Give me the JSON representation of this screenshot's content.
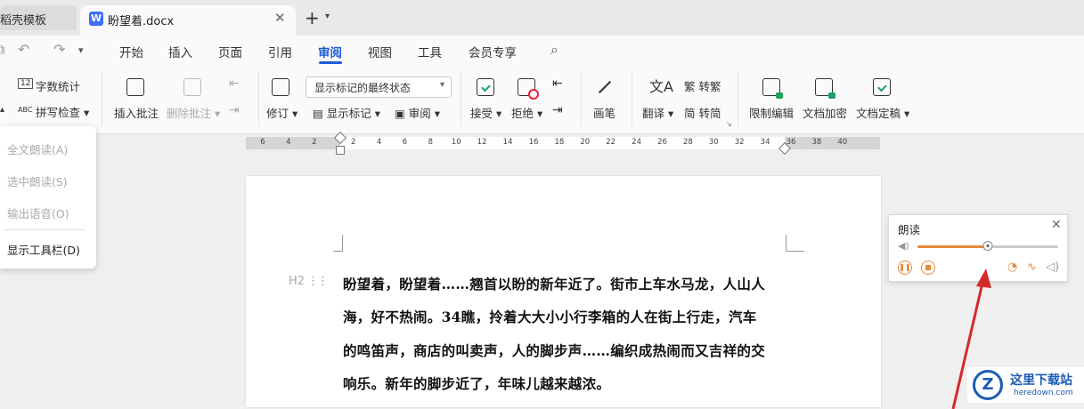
{
  "tabs": {
    "inactive_label": "稻壳模板",
    "active_label": "盼望着.docx",
    "doc_icon_letter": "W"
  },
  "menu": {
    "items": [
      "开始",
      "插入",
      "页面",
      "引用",
      "审阅",
      "视图",
      "工具",
      "会员专享"
    ],
    "active": "审阅"
  },
  "ribbon": {
    "word_count": "字数统计",
    "spell_check": "拼写检查",
    "insert_comment": "插入批注",
    "delete_comment": "删除批注",
    "revise": "修订",
    "markup_state": "显示标记的最终状态",
    "show_markup": "显示标记",
    "review": "审阅",
    "accept": "接受",
    "reject": "拒绝",
    "pen": "画笔",
    "translate": "翻译",
    "to_traditional": "转繁",
    "to_simplified": "转简",
    "restrict_edit": "限制编辑",
    "encrypt_doc": "文档加密",
    "finalize_doc": "文档定稿",
    "word_count_icon_text": "12",
    "spell_check_icon_text": "ABC"
  },
  "sidemenu": {
    "items": [
      "全文朗读(A)",
      "选中朗读(S)",
      "输出语音(O)",
      "显示工具栏(D)"
    ]
  },
  "ruler": {
    "ticks": [
      "6",
      "4",
      "2",
      "2",
      "4",
      "6",
      "8",
      "10",
      "12",
      "14",
      "16",
      "18",
      "20",
      "22",
      "24",
      "26",
      "28",
      "30",
      "32",
      "34",
      "36",
      "38",
      "40"
    ]
  },
  "document": {
    "heading_style": "H2",
    "lines": [
      "盼望着，盼望着……翘首以盼的新年近了。街市上车水马龙，人山人",
      "海，好不热闹。34瞧，拎着大大小小行李箱的人在街上行走，汽车",
      "的鸣笛声，商店的叫卖声，人的脚步声……编织成热闹而又吉祥的交",
      "响乐。新年的脚步近了，年味儿越来越浓。"
    ]
  },
  "read_panel": {
    "title": "朗读",
    "progress": 0.5,
    "accent_color": "#e58a3a"
  },
  "watermark": {
    "logo": "Z",
    "name": "这里下载站",
    "url": "heredown.com"
  }
}
